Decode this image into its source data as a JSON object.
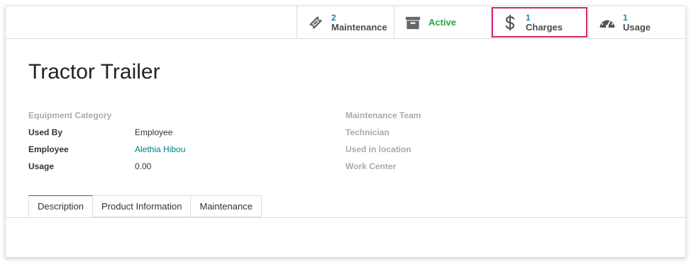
{
  "colors": {
    "link": "#017e84",
    "active": "#28a745",
    "stat_number": "#2a7fa8",
    "highlight": "#d6246e"
  },
  "stat_buttons": [
    {
      "number": "2",
      "label": "Maintenance",
      "icon": "ticket-icon"
    },
    {
      "number": "",
      "label": "Active",
      "icon": "archive-icon"
    },
    {
      "number": "1",
      "label": "Charges",
      "icon": "dollar-icon"
    },
    {
      "number": "1",
      "label": "Usage",
      "icon": "gauge-icon"
    }
  ],
  "record": {
    "title": "Tractor Trailer"
  },
  "left_fields": [
    {
      "label": "Equipment Category",
      "value": ""
    },
    {
      "label": "Used By",
      "value": "Employee"
    },
    {
      "label": "Employee",
      "value": "Alethia Hibou"
    },
    {
      "label": "Usage",
      "value": "0.00"
    }
  ],
  "right_fields": [
    {
      "label": "Maintenance Team",
      "value": ""
    },
    {
      "label": "Technician",
      "value": ""
    },
    {
      "label": "Used in location",
      "value": ""
    },
    {
      "label": "Work Center",
      "value": ""
    }
  ],
  "tabs": [
    {
      "label": "Description"
    },
    {
      "label": "Product Information"
    },
    {
      "label": "Maintenance"
    }
  ]
}
